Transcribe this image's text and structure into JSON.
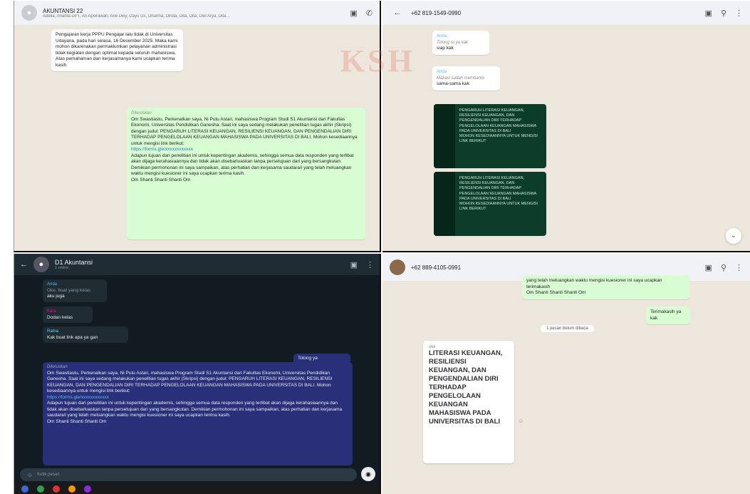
{
  "p1": {
    "group_name": "AKUNTANSI 22",
    "members": "Adelia, Ananta DPT, Ari Apsirawan, Arie Dwy, Dayu Gs, Dharma, Dinda, Dita, Dita, Dwi Arya, Dita...",
    "msg1": "Pengajaran kerja PPPU Pengajar lalu tidak di Universitas Udayana, pada hari selasa, 16 Desember 2025. Maka kami mohon dikarenakan permaklumkan pelayanan administrasi tidak kegiatan dengan optimal kepada seluruh mahasiswa. Atas pemahaman dan kerjasamanya kami ucapkan terima kasih",
    "fwd": "Diteruskan",
    "body": "Om Swastiastu, Perkenalkan saya, Ni Putu Astari, mahasiswa Program Studi S1 Akuntansi dari Fakultas Ekonomi, Universitas Pendidikan Ganesha. Saat ini saya sedang melakukan penelitian tugas akhir (Skripsi) dengan judul: PENGARUH LITERASI KEUANGAN, RESILIENSI KEUANGAN, DAN PENGENDALIAN DIRI TERHADAP PENGELOLAAN KEUANGAN MAHASISWA PADA UNIVERSITAS DI BALI. Mohon kesediaannya untuk mengisi link berikut:",
    "link": "https://forms.gle/xxxxxxxxxxxx",
    "body2": "Adapun tujuan dari penelitian ini untuk kepentingan akademis, sehingga semua data responden yang terlibat akan dijaga kerahasiaannya dan tidak akan disebarluaskan tanpa persetujuan dari yang bersangkutan. Demikian permohonan ini saya sampaikan, atas perhatian dan kerjasama saudara/i yang telah meluangkan waktu mengisi kuesioner ini saya ucapkan terima kasih.",
    "closing": "Om Shanti Shanti Shanti Om"
  },
  "p2": {
    "phone": "+62 819-1549-0990",
    "q1_name": "Anda",
    "q1_text": "Tolong isi ya kak",
    "r1": "siap kak",
    "q2_name": "Anda",
    "q2_text": "Makasi sudah membantu",
    "r2": "sama-sama kak",
    "card_text": "PENGARUH LITERASI KEUANGAN, RESILIENSI KEUANGAN, DAN PENGENDALIAN DIRI TERHADAP PENGELOLAAN KEUANGAN MAHASISWA PADA UNIVERSITAS DI BALI",
    "card_sub": "Mohon kesediaannya untuk mengisi link berikut",
    "watermark": "KSH"
  },
  "p3": {
    "title": "D1 Akuntansi",
    "status": "1 online",
    "m1_name": "Anda",
    "m1_q": "Oke, buat yang kelas",
    "m1": "aku juga",
    "m2_name": "Kara",
    "m2": "Dodan kelas",
    "m3_name": "Ratna",
    "m3": "Kak buat link apa ya gan",
    "tag": "Tolong ya",
    "fwd": "Diteruskan",
    "body": "Om Swastiastu, Perkenalkan saya, Ni Putu Astari, mahasiswa Program Studi S1 Akuntansi dari Fakultas Ekonomi, Universitas Pendidikan Ganesha. Saat ini saya sedang melakukan penelitian tugas akhir (Skripsi) dengan judul: PENGARUH LITERASI KEUANGAN, RESILIENSI KEUANGAN, DAN PENGENDALIAN DIRI TERHADAP PENGELOLAAN KEUANGAN MAHASISWA PADA UNIVERSITAS DI BALI. Mohon kesediaannya untuk mengisi link berikut:",
    "link": "https://forms.gle/xxxxxxxxxxxx",
    "body2": "Adapun tujuan dari penelitian ini untuk kepentingan akademis, sehingga semua data responden yang terlibat akan dijaga kerahasiaannya dan tidak akan disebarluaskan tanpa persetujuan dari yang bersangkutan. Demikian permohonan ini saya sampaikan, atas perhatian dan kerjasama saudara/i yang telah meluangkan waktu mengisi kuesioner ini saya ucapkan terima kasih.",
    "closing": "Om Shanti Shanti Shanti Om",
    "input_placeholder": "Ketik pesan"
  },
  "p4": {
    "phone": "+62 889-4105-0991",
    "top_text": "yang telah meluangkan waktu mengisi kuesioner ini saya ucapkan terimakasih",
    "top_closing": "Om Shanti Shanti Shanti Om",
    "thanks": "Terimakasih ya kak",
    "unread": "1 pesan belum dibaca",
    "card_head": "oke",
    "card_title": "LITERASI KEUANGAN, RESILIENSI KEUANGAN, DAN PENGENDALIAN DIRI TERHADAP PENGELOLAAN KEUANGAN MAHASISWA PADA UNIVERSITAS DI BALI"
  }
}
